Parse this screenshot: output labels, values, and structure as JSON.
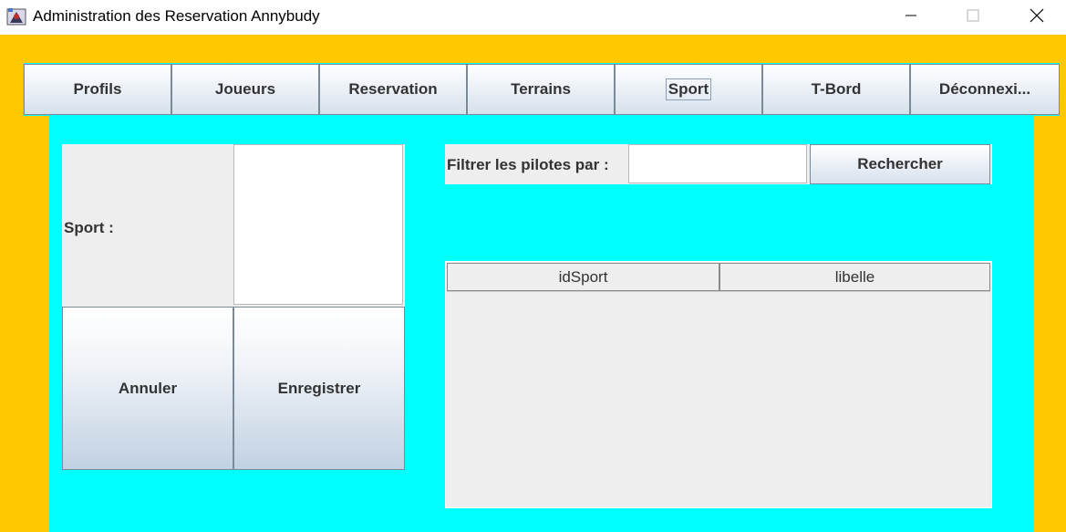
{
  "window": {
    "title": "Administration des Reservation Annybudy"
  },
  "menu": {
    "items": [
      {
        "label": "Profils"
      },
      {
        "label": "Joueurs"
      },
      {
        "label": "Reservation"
      },
      {
        "label": "Terrains"
      },
      {
        "label": "Sport",
        "selected": true
      },
      {
        "label": "T-Bord"
      },
      {
        "label": "Déconnexi..."
      }
    ]
  },
  "form": {
    "sport_label": "Sport :",
    "sport_value": "",
    "cancel_label": "Annuler",
    "save_label": "Enregistrer"
  },
  "filter": {
    "label": "Filtrer les pilotes par :",
    "value": "",
    "search_label": "Rechercher"
  },
  "table": {
    "columns": [
      "idSport",
      "libelle"
    ],
    "rows": []
  },
  "colors": {
    "frame": "#FFC800",
    "content": "#00FFFF",
    "panel": "#EEEEEE"
  }
}
